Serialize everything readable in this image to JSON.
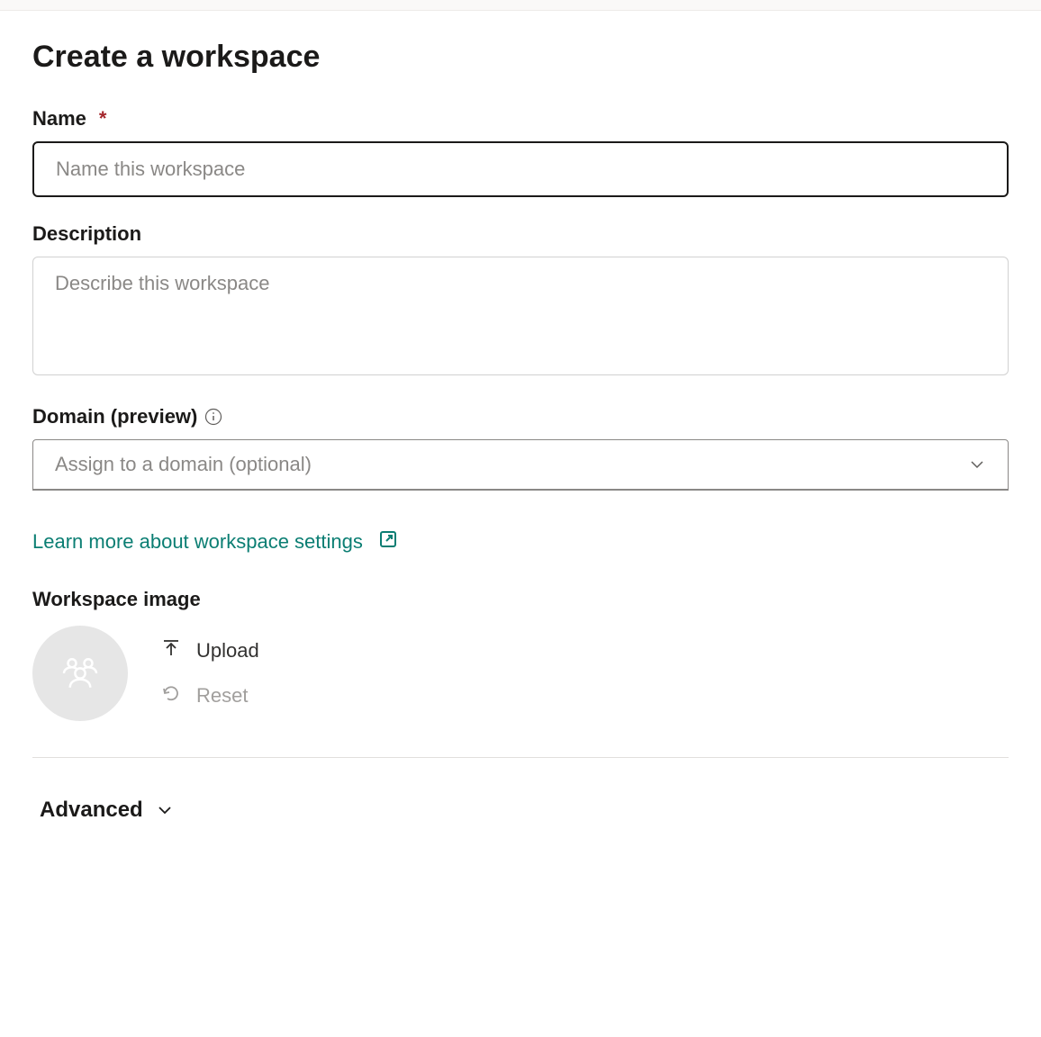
{
  "page": {
    "title": "Create a workspace"
  },
  "fields": {
    "name": {
      "label": "Name",
      "required_indicator": "*",
      "placeholder": "Name this workspace",
      "value": ""
    },
    "description": {
      "label": "Description",
      "placeholder": "Describe this workspace",
      "value": ""
    },
    "domain": {
      "label": "Domain (preview)",
      "placeholder": "Assign to a domain (optional)",
      "value": ""
    }
  },
  "links": {
    "learn_more": "Learn more about workspace settings"
  },
  "workspace_image": {
    "label": "Workspace image",
    "upload_label": "Upload",
    "reset_label": "Reset"
  },
  "advanced": {
    "label": "Advanced"
  }
}
